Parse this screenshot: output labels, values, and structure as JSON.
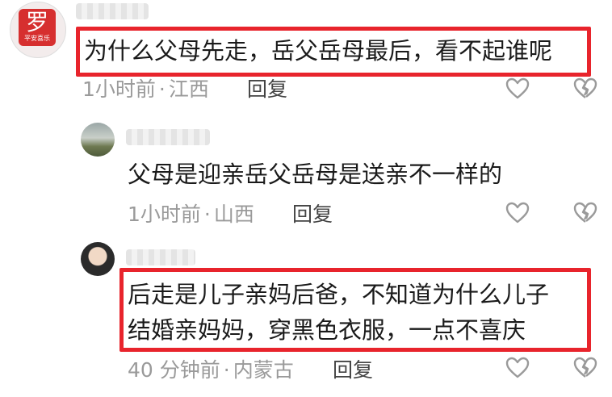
{
  "comments": [
    {
      "text": "为什么父母先走，岳父岳母最后，看不起谁呢",
      "time": "1小时前",
      "location": "江西",
      "reply_label": "回复",
      "avatar_text": "罗",
      "avatar_caption": "平安喜乐"
    },
    {
      "text": "父母是迎亲岳父岳母是送亲不一样的",
      "time": "1小时前",
      "location": "山西",
      "reply_label": "回复"
    },
    {
      "text_line1": "后走是儿子亲妈后爸，不知道为什么儿子",
      "text_line2": "结婚亲妈妈，穿黑色衣服，一点不喜庆",
      "time": "40 分钟前",
      "location": "内蒙古",
      "reply_label": "回复"
    }
  ],
  "separator": "·",
  "icons": {
    "like": "heart-icon",
    "dislike": "broken-heart-icon"
  },
  "colors": {
    "highlight": "#e8242c",
    "meta": "#9a9a9a"
  }
}
